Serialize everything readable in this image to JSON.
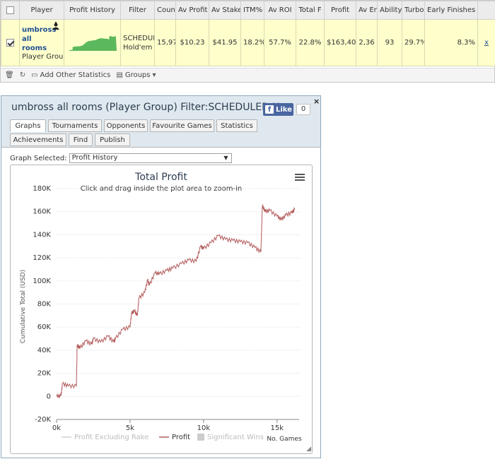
{
  "stats": {
    "columns": [
      "",
      "Player",
      "Profit History",
      "Filter",
      "Count",
      "Av Profit",
      "Av Stake",
      "ITM%",
      "Av ROI",
      "Total F",
      "Profit",
      "Av En",
      "Ability",
      "Turbo",
      "Early Finishes",
      ""
    ],
    "row": {
      "player_name": "umbross all rooms",
      "player_type": "Player Group",
      "filter": "SCHEDULED Hold'em",
      "count": "15,97",
      "av_profit": "$10.23",
      "av_stake": "$41.95",
      "itm": "18.2%",
      "av_roi": "57.7%",
      "total_f": "22.8%",
      "profit": "$163,40",
      "av_en": "2,36",
      "ability": "93",
      "turbo": "29.7%",
      "early_finishes": "8.3%",
      "remove": "x"
    },
    "toolbar": {
      "add_label": "Add Other Statistics",
      "groups_label": "Groups"
    }
  },
  "graph_window": {
    "title": "umbross all rooms (Player Group) Filter:SCHEDULED H",
    "fb_like": "Like",
    "fb_count": "0",
    "close": "×",
    "tabs_row1": [
      "Graphs",
      "Tournaments",
      "Opponents",
      "Favourite Games",
      "Statistics"
    ],
    "tabs_row2": [
      "Achievements",
      "Find",
      "Publish"
    ],
    "active_tab": "Graphs",
    "graph_selected_label": "Graph Selected:",
    "graph_selected_value": "Profit History"
  },
  "colors": {
    "profit_line": "#b35a5a",
    "sparkline": "#5cb85c",
    "accent": "#1f4f93"
  },
  "chart_data": {
    "type": "line",
    "title": "Total Profit",
    "subtitle": "Click and drag inside the plot area to zoom-in",
    "xlabel": "No. Games",
    "ylabel": "Cumulative Total (USD)",
    "xlim": [
      0,
      16500
    ],
    "ylim": [
      -20000,
      180000
    ],
    "xticks": [
      "0k",
      "5k",
      "10k",
      "15k"
    ],
    "yticks": [
      "-20K",
      "0",
      "20K",
      "40K",
      "60K",
      "80K",
      "100K",
      "120K",
      "140K",
      "160K",
      "180K"
    ],
    "grid": true,
    "legend_position": "bottom",
    "legend": [
      "Profit Excluding Rake",
      "Profit",
      "Significant Wins"
    ],
    "series": [
      {
        "name": "Profit",
        "x": [
          0,
          300,
          400,
          800,
          1350,
          1400,
          1600,
          2000,
          2400,
          2500,
          3000,
          3500,
          3900,
          4000,
          4500,
          5000,
          5100,
          5300,
          5500,
          5600,
          6000,
          6200,
          6300,
          6700,
          7000,
          7500,
          7900,
          8500,
          9000,
          9500,
          9800,
          10000,
          10500,
          11000,
          11500,
          12000,
          12500,
          13000,
          13500,
          13900,
          14000,
          14200,
          14500,
          15000,
          15300,
          15600,
          16000,
          16200
        ],
        "y": [
          0,
          500,
          11000,
          9000,
          9000,
          44000,
          42000,
          48000,
          45000,
          50000,
          47000,
          52000,
          47000,
          50000,
          58000,
          60000,
          72000,
          74000,
          70000,
          85000,
          90000,
          101000,
          96000,
          107000,
          106000,
          109000,
          111000,
          115000,
          118000,
          117000,
          130000,
          128000,
          133000,
          139000,
          136000,
          135000,
          134000,
          133000,
          129000,
          125000,
          165000,
          160000,
          161000,
          156000,
          153000,
          157000,
          159000,
          162000
        ]
      }
    ]
  }
}
